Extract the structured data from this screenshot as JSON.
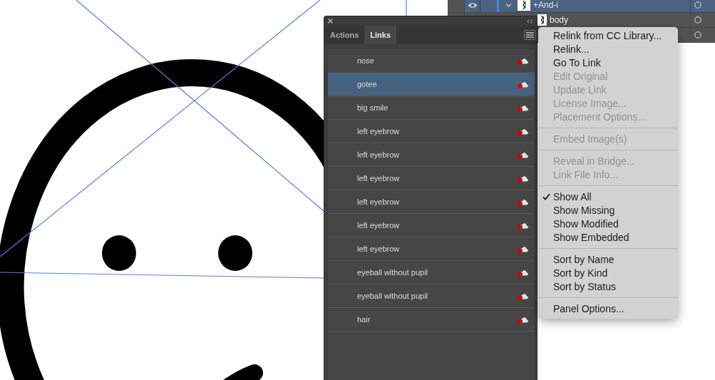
{
  "layers_panel": {
    "rows": [
      {
        "kind": "layer",
        "name": "+And-i",
        "selected": true,
        "expanded": true
      },
      {
        "kind": "sublayer",
        "name": "body",
        "selected": false
      },
      {
        "kind": "sublayer",
        "selected": false
      }
    ]
  },
  "links_panel": {
    "tabs": [
      {
        "label": "Actions",
        "selected": false
      },
      {
        "label": "Links",
        "selected": true
      }
    ],
    "items": [
      {
        "name": "nose",
        "selected": false
      },
      {
        "name": "gotee",
        "selected": true
      },
      {
        "name": "big smile",
        "selected": false
      },
      {
        "name": "left eyebrow",
        "selected": false
      },
      {
        "name": "left eyebrow",
        "selected": false
      },
      {
        "name": "left eyebrow",
        "selected": false
      },
      {
        "name": "left eyebrow",
        "selected": false
      },
      {
        "name": "left eyebrow",
        "selected": false
      },
      {
        "name": "left eyebrow",
        "selected": false
      },
      {
        "name": "eyeball without pupil",
        "selected": false
      },
      {
        "name": "eyeball without pupil",
        "selected": false
      },
      {
        "name": "hair",
        "selected": false
      }
    ]
  },
  "panel_menu": {
    "sections": [
      {
        "items": [
          {
            "label": "Relink from CC Library...",
            "disabled": false,
            "checked": false
          },
          {
            "label": "Relink...",
            "disabled": false,
            "checked": false
          },
          {
            "label": "Go To Link",
            "disabled": false,
            "checked": false
          },
          {
            "label": "Edit Original",
            "disabled": true,
            "checked": false
          },
          {
            "label": "Update Link",
            "disabled": true,
            "checked": false
          },
          {
            "label": "License Image...",
            "disabled": true,
            "checked": false
          },
          {
            "label": "Placement Options...",
            "disabled": true,
            "checked": false
          }
        ]
      },
      {
        "items": [
          {
            "label": "Embed Image(s)",
            "disabled": true,
            "checked": false
          }
        ]
      },
      {
        "items": [
          {
            "label": "Reveal in Bridge...",
            "disabled": true,
            "checked": false
          },
          {
            "label": "Link File Info...",
            "disabled": true,
            "checked": false
          }
        ]
      },
      {
        "items": [
          {
            "label": "Show All",
            "disabled": false,
            "checked": true
          },
          {
            "label": "Show Missing",
            "disabled": false,
            "checked": false
          },
          {
            "label": "Show Modified",
            "disabled": false,
            "checked": false
          },
          {
            "label": "Show Embedded",
            "disabled": false,
            "checked": false
          }
        ]
      },
      {
        "items": [
          {
            "label": "Sort by Name",
            "disabled": false,
            "checked": false
          },
          {
            "label": "Sort by Kind",
            "disabled": false,
            "checked": false
          },
          {
            "label": "Sort by Status",
            "disabled": false,
            "checked": false
          }
        ]
      },
      {
        "items": [
          {
            "label": "Panel Options...",
            "disabled": false,
            "checked": false
          }
        ]
      }
    ]
  }
}
